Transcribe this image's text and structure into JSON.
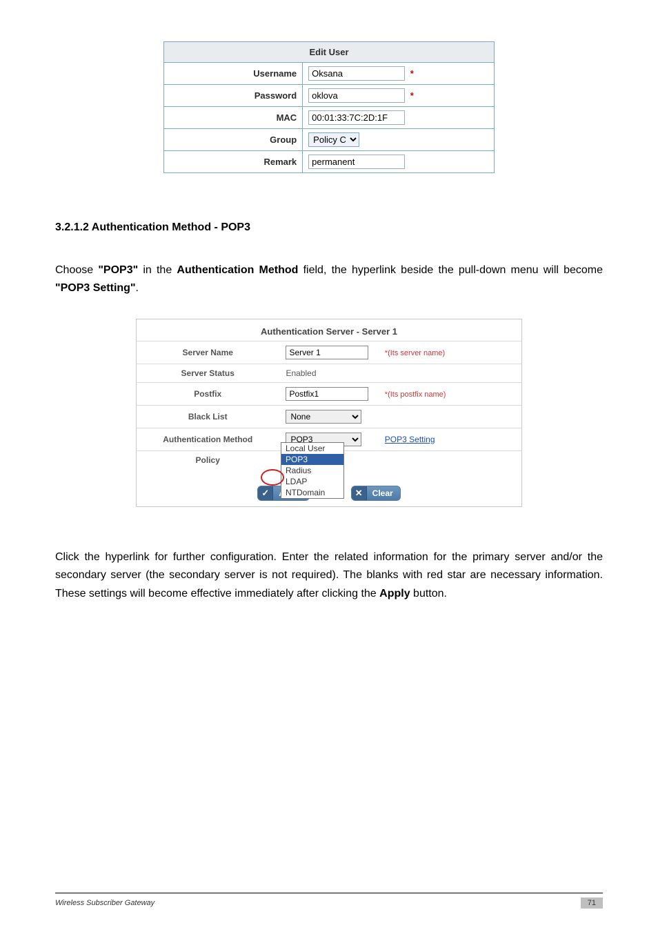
{
  "edit_user": {
    "header": "Edit User",
    "rows": {
      "username": {
        "label": "Username",
        "value": "Oksana",
        "star": "*"
      },
      "password": {
        "label": "Password",
        "value": "oklova",
        "star": "*"
      },
      "mac": {
        "label": "MAC",
        "value": "00:01:33:7C:2D:1F"
      },
      "group": {
        "label": "Group",
        "value": "Policy C"
      },
      "remark": {
        "label": "Remark",
        "value": "permanent"
      }
    }
  },
  "section_heading": "3.2.1.2 Authentication Method - POP3",
  "para1": {
    "t1": "Choose ",
    "b1": "\"POP3\"",
    "t2": " in the ",
    "b2": "Authentication Method",
    "t3": " field, the hyperlink beside the pull-down menu will become ",
    "b3": "\"POP3 Setting\"",
    "t4": "."
  },
  "auth": {
    "title": "Authentication Server - Server 1",
    "server_name": {
      "label": "Server Name",
      "value": "Server 1",
      "hint": "*(Its server name)"
    },
    "server_status": {
      "label": "Server Status",
      "value": "Enabled"
    },
    "postfix": {
      "label": "Postfix",
      "value": "Postfix1",
      "hint": "*(Its postfix name)"
    },
    "black_list": {
      "label": "Black List",
      "value": "None"
    },
    "auth_method": {
      "label": "Authentication Method",
      "value": "POP3",
      "link": "POP3 Setting"
    },
    "policy": {
      "label": "Policy"
    },
    "dropdown": [
      "Local User",
      "POP3",
      "Radius",
      "LDAP",
      "NTDomain"
    ],
    "buttons": {
      "apply_icon": "✓",
      "apply": "Apply",
      "clear_icon": "✕",
      "clear": "Clear"
    }
  },
  "para2": {
    "t1": "Click the hyperlink for further configuration. Enter the related information for the primary server and/or the secondary server (the secondary server is not required). The blanks with red star are necessary information. These settings will become effective immediately after clicking the ",
    "b1": "Apply",
    "t2": " button."
  },
  "footer": {
    "left": "Wireless Subscriber Gateway",
    "page": "71"
  }
}
